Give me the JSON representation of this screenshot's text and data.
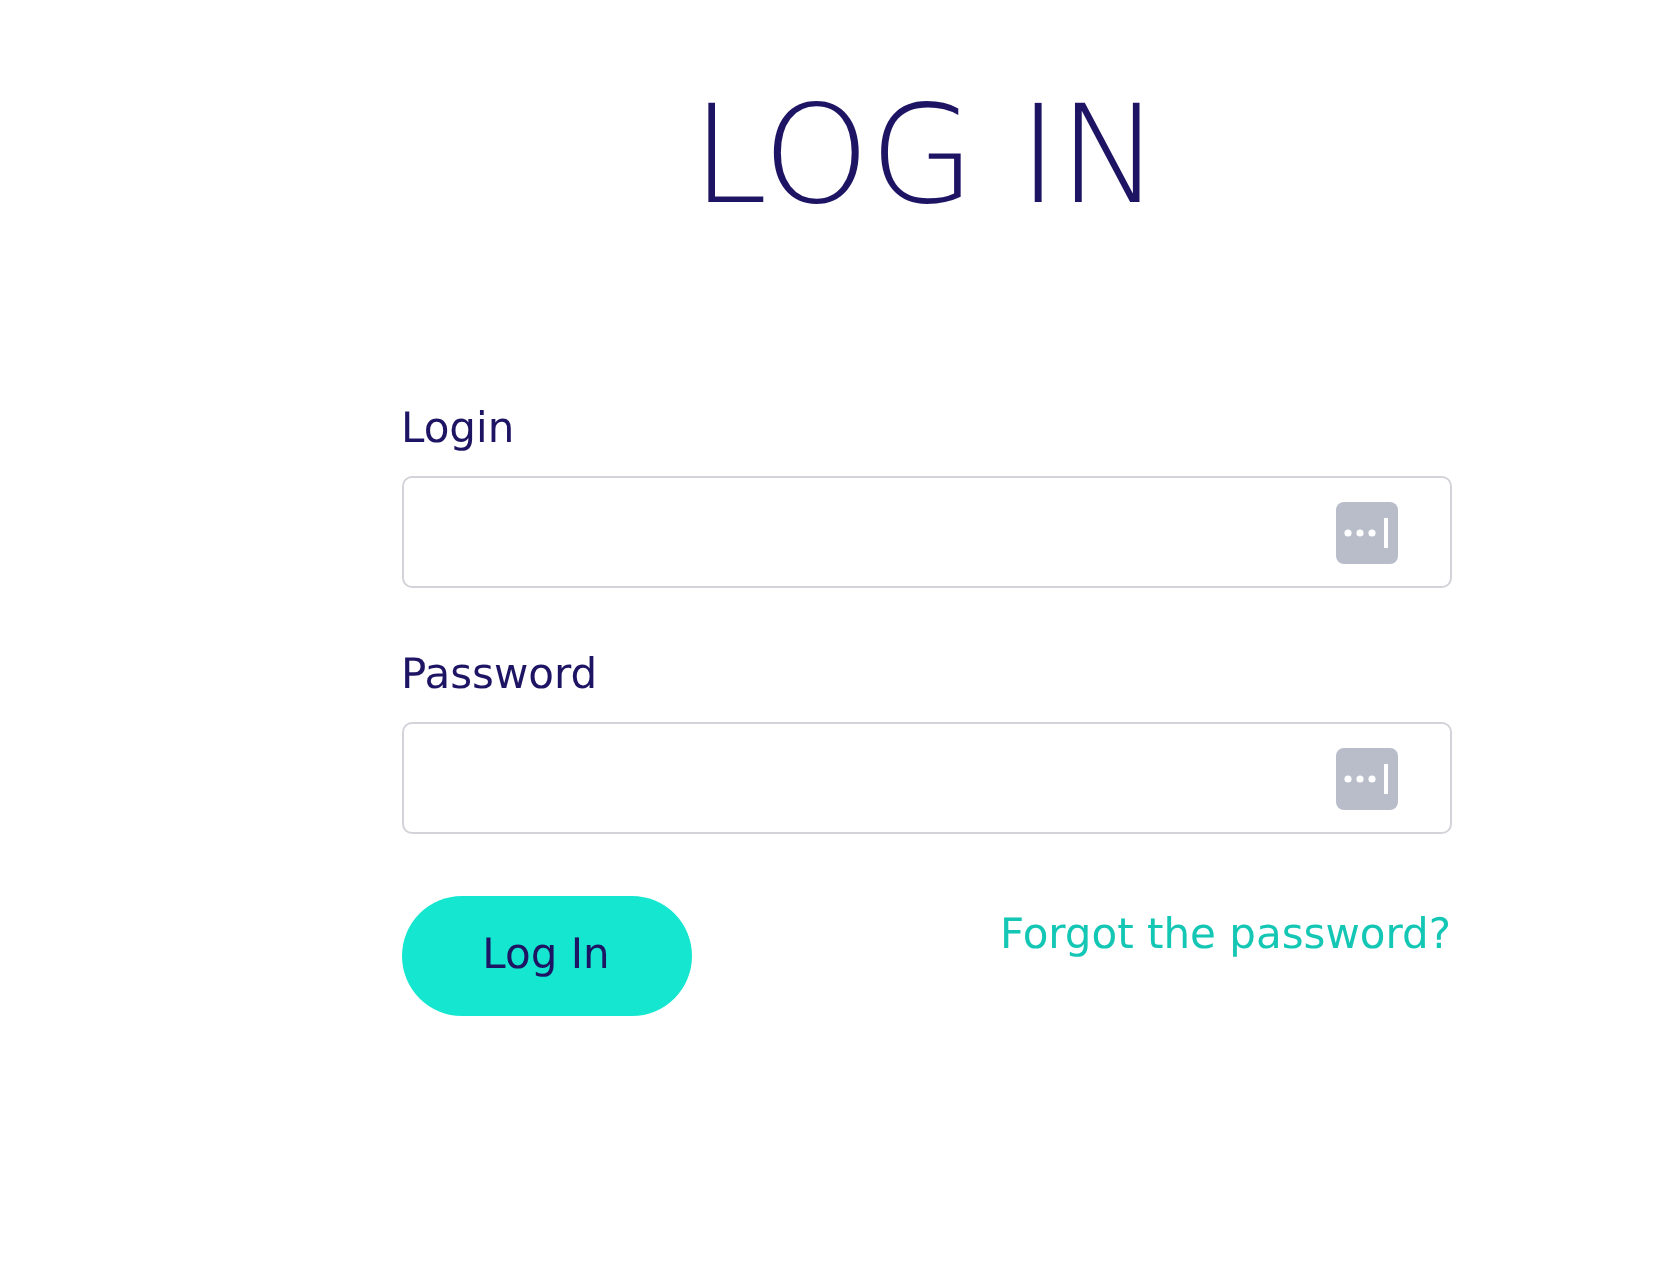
{
  "title": "LOG IN",
  "fields": [
    {
      "label": "Login"
    },
    {
      "label": "Password"
    }
  ],
  "submit": {
    "label": "Log In"
  },
  "forgot_link": {
    "label": "Forgot the password?"
  }
}
